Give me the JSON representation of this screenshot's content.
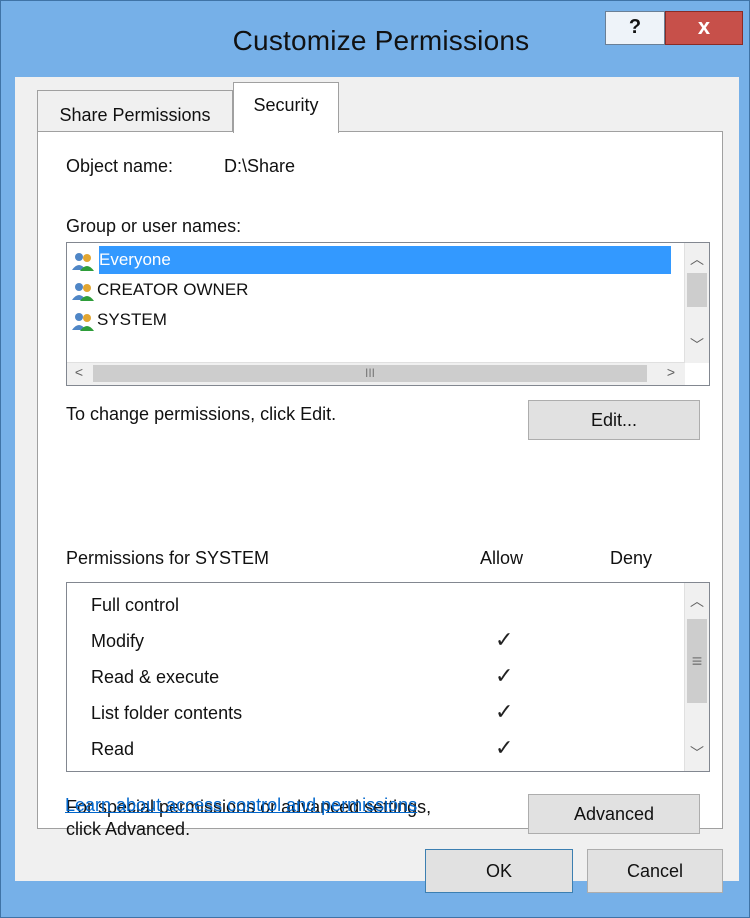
{
  "window": {
    "title": "Customize Permissions",
    "help_label": "?",
    "close_label": "x"
  },
  "tabs": [
    {
      "label": "Share Permissions"
    },
    {
      "label": "Security"
    }
  ],
  "object": {
    "label": "Object name:",
    "value": "D:\\Share"
  },
  "groups": {
    "label": "Group or user names:",
    "items": [
      {
        "label": "Everyone",
        "icon": "users-icon",
        "selected": true
      },
      {
        "label": "CREATOR OWNER",
        "icon": "users-icon",
        "selected": false
      },
      {
        "label": "SYSTEM",
        "icon": "users-icon",
        "selected": false
      }
    ],
    "hscroll_thumb_glyph": "III"
  },
  "edit": {
    "hint": "To change permissions, click Edit.",
    "button_label": "Edit..."
  },
  "permissions": {
    "header": "Permissions for SYSTEM",
    "allow_label": "Allow",
    "deny_label": "Deny",
    "rows": [
      {
        "name": "Full control",
        "allow": false,
        "deny": false
      },
      {
        "name": "Modify",
        "allow": true,
        "deny": false
      },
      {
        "name": "Read & execute",
        "allow": true,
        "deny": false
      },
      {
        "name": "List folder contents",
        "allow": true,
        "deny": false
      },
      {
        "name": "Read",
        "allow": true,
        "deny": false
      }
    ],
    "check_glyph": "✓",
    "scroll_grip_glyph": "≡"
  },
  "advanced": {
    "hint_line1": "For special permissions or advanced settings,",
    "hint_line2": "click Advanced.",
    "button_label": "Advanced"
  },
  "link": {
    "label": "Learn about access control and permissions"
  },
  "footer": {
    "ok_label": "OK",
    "cancel_label": "Cancel"
  },
  "colors": {
    "frame": "#76b0e8",
    "selection": "#3399ff",
    "close": "#c7504a",
    "link": "#0066cc"
  }
}
